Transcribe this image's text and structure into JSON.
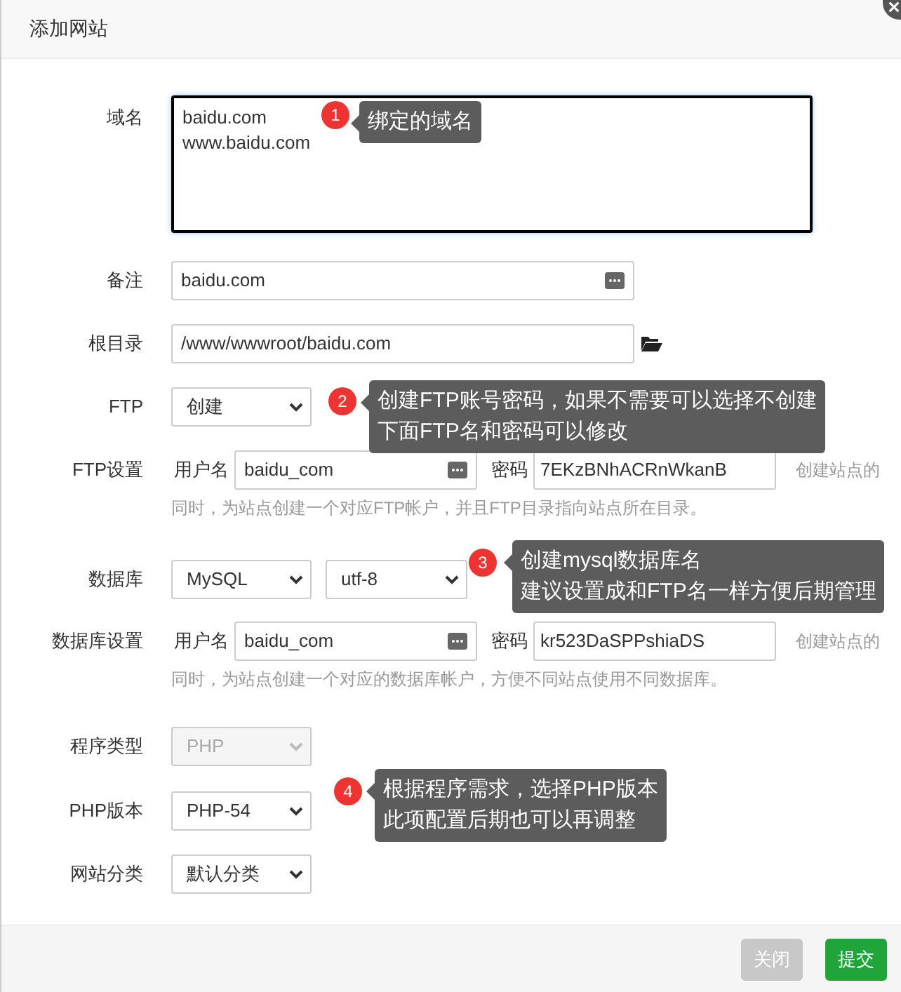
{
  "dialog": {
    "title": "添加网站"
  },
  "rows": [
    {
      "kind": "textarea",
      "label": "域名",
      "value": "baidu.com\nwww.baidu.com",
      "focused": true
    },
    {
      "kind": "text",
      "label": "备注",
      "value": "baidu.com"
    },
    {
      "kind": "path",
      "label": "根目录",
      "value": "/www/wwwroot/baidu.com"
    },
    {
      "kind": "select",
      "label": "FTP",
      "selects": [
        {
          "value": "创建",
          "disabled": false
        }
      ]
    },
    {
      "kind": "credentials",
      "label": "FTP设置",
      "user_label": "用户名",
      "user": "baidu_com",
      "pass_label": "密码",
      "pass": "7EKzBNhACRnWkanB",
      "hint_lines": [
        "创建站点的",
        "同时，为站点创建一个对应FTP帐户，并且FTP目录指向站点所在目录。"
      ]
    },
    {
      "kind": "select",
      "label": "数据库",
      "selects": [
        {
          "value": "MySQL",
          "disabled": false
        },
        {
          "value": "utf-8",
          "disabled": false
        }
      ]
    },
    {
      "kind": "credentials",
      "label": "数据库设置",
      "user_label": "用户名",
      "user": "baidu_com",
      "pass_label": "密码",
      "pass": "kr523DaSPPshiaDS",
      "hint_lines": [
        "创建站点的",
        "同时，为站点创建一个对应的数据库帐户，方便不同站点使用不同数据库。"
      ]
    },
    {
      "kind": "select",
      "label": "程序类型",
      "selects": [
        {
          "value": "PHP",
          "disabled": true
        }
      ]
    },
    {
      "kind": "select",
      "label": "PHP版本",
      "selects": [
        {
          "value": "PHP-54",
          "disabled": false
        }
      ]
    },
    {
      "kind": "select",
      "label": "网站分类",
      "selects": [
        {
          "value": "默认分类",
          "disabled": false
        }
      ]
    }
  ],
  "annotations": [
    {
      "number": "1",
      "lines": [
        "绑定的域名"
      ]
    },
    {
      "number": "2",
      "lines": [
        "创建FTP账号密码，如果不需要可以选择不创建",
        "下面FTP名和密码可以修改"
      ]
    },
    {
      "number": "3",
      "lines": [
        "创建mysql数据库名",
        "建议设置成和FTP名一样方便后期管理"
      ]
    },
    {
      "number": "4",
      "lines": [
        "根据程序需求，选择PHP版本",
        "此项配置后期也可以再调整"
      ]
    }
  ],
  "buttons": [
    {
      "label": "关闭",
      "kind": "secondary"
    },
    {
      "label": "提交",
      "kind": "primary"
    }
  ]
}
